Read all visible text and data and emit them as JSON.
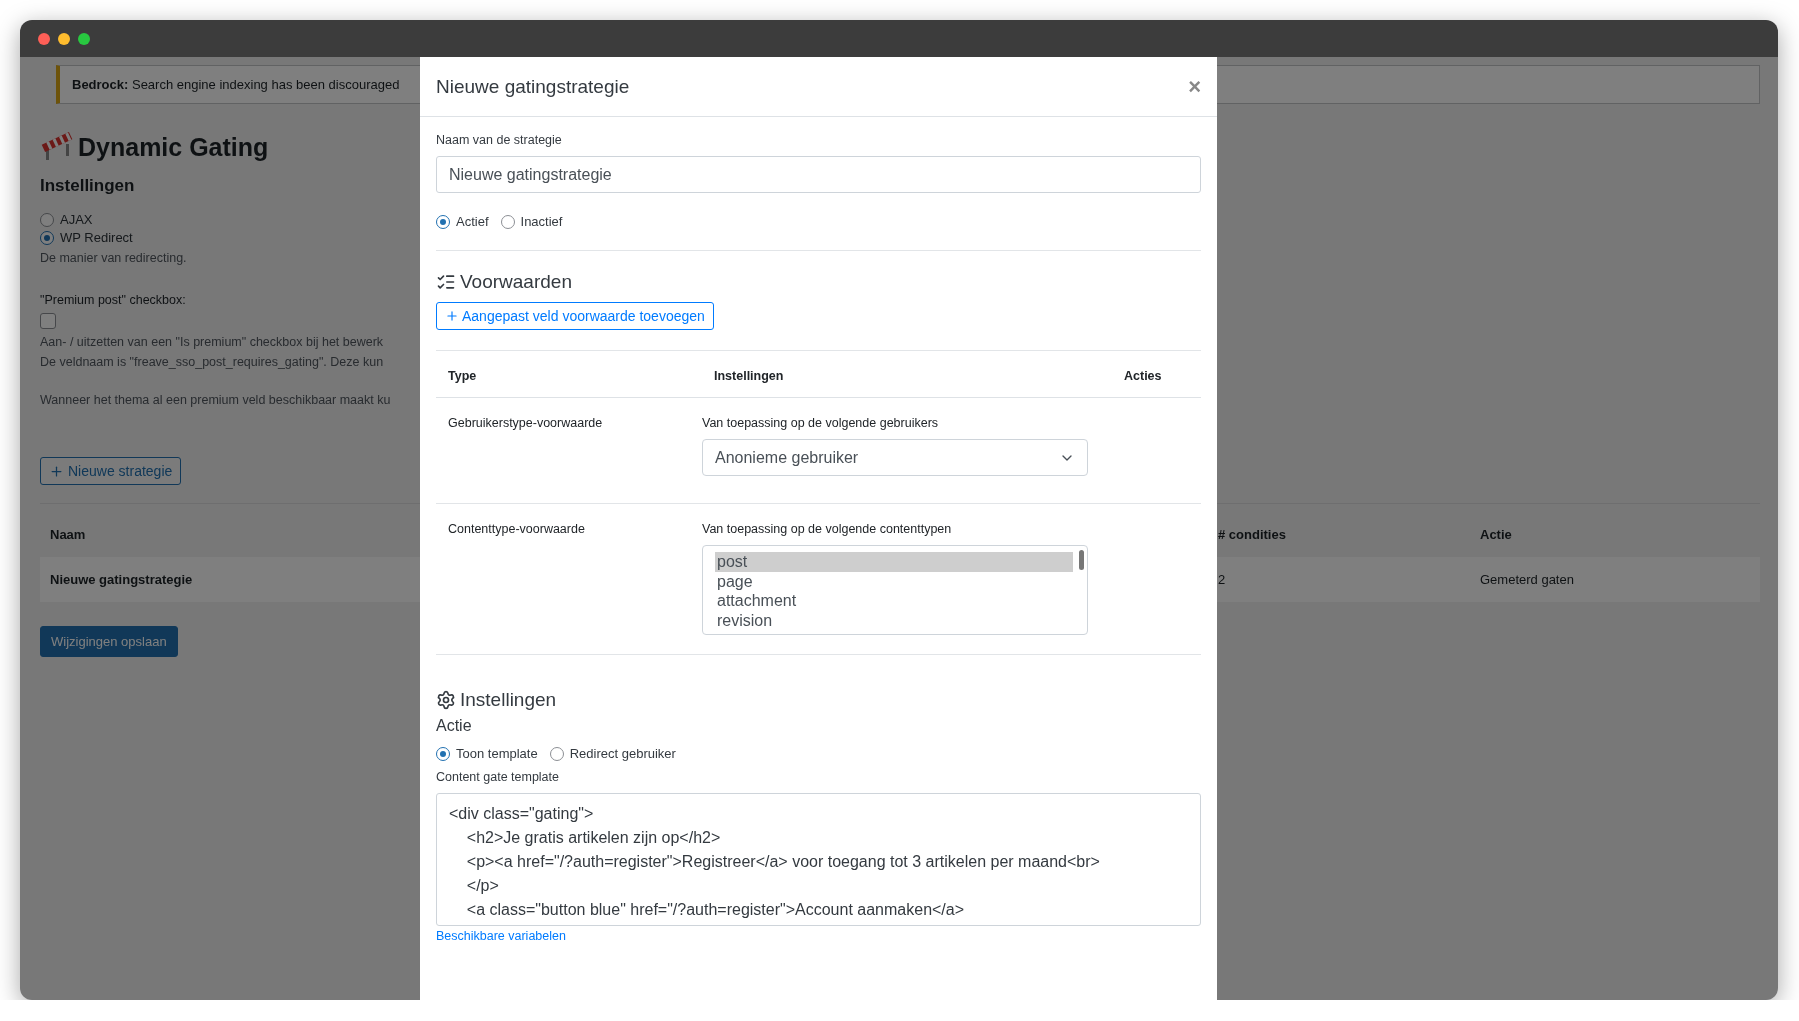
{
  "notice": {
    "text": "**Bedrock:** Search engine indexing has been discouraged"
  },
  "page": {
    "title": "Dynamic Gating",
    "section": "Instellingen",
    "redirect_options": [
      {
        "label": "AJAX",
        "selected": false
      },
      {
        "label": "WP Redirect",
        "selected": true
      }
    ],
    "redirect_help": "De manier van redirecting.",
    "premium_label": "\"Premium post\" checkbox:",
    "premium_checked": false,
    "premium_help": [
      "Aan- / uitzetten van een \"Is premium\" checkbox bij het bewerk",
      "De veldnaam is \"freave_sso_post_requires_gating\". Deze kun"
    ],
    "theme_note": "Wanneer het thema al een premium veld beschikbaar maakt ku",
    "new_button": "Nieuwe strategie",
    "table": {
      "columns": [
        "Naam",
        "# condities",
        "Actie"
      ],
      "rows": [
        {
          "cells": [
            "Nieuwe gatingstrategie",
            "2",
            "Gemeterd gaten"
          ]
        }
      ]
    },
    "save_button": "Wijzigingen opslaan"
  },
  "modal": {
    "title": "Nieuwe gatingstrategie",
    "close": "×",
    "name_label": "Naam van de strategie",
    "name_value": "Nieuwe gatingstrategie",
    "status_options": [
      {
        "label": "Actief",
        "selected": true
      },
      {
        "label": "Inactief",
        "selected": false
      }
    ],
    "conditions_heading": "Voorwaarden",
    "add_button": "Aangepast veld voorwaarde toevoegen",
    "columns": [
      "Type",
      "Instellingen",
      "Acties"
    ],
    "conditions": [
      {
        "kind": "select",
        "type": "Gebruikerstype-voorwaarde",
        "label": "Van toepassing op de volgende gebruikers",
        "value": "Anonieme gebruiker"
      },
      {
        "kind": "listbox",
        "type": "Contenttype-voorwaarde",
        "label": "Van toepassing op de volgende contenttypen",
        "options": [
          {
            "label": "post",
            "selected": true
          },
          {
            "label": "page",
            "selected": false
          },
          {
            "label": "attachment",
            "selected": false
          },
          {
            "label": "revision",
            "selected": false
          }
        ]
      }
    ],
    "settings_heading": "Instellingen",
    "action_label": "Actie",
    "action_options": [
      {
        "label": "Toon template",
        "selected": true
      },
      {
        "label": "Redirect gebruiker",
        "selected": false
      }
    ],
    "template_label": "Content gate template",
    "template_lines": [
      "<div class=\"gating\">",
      "    <h2>Je gratis artikelen zijn op</h2>",
      "    <p><a href=\"/?auth=register\">Registreer</a> voor toegang tot 3 artikelen per maand<br>",
      "    </p>",
      "    <a class=\"button blue\" href=\"/?auth=register\">Account aanmaken</a>"
    ],
    "variables_link": "Beschikbare variabelen"
  }
}
